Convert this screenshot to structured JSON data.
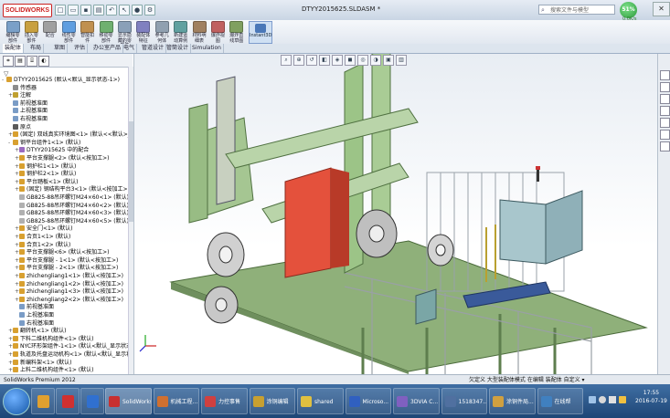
{
  "app": {
    "name": "SOLIDWORKS",
    "document_title": "DTYY2015625.SLDASM *",
    "search_placeholder": "搜索文件与模型",
    "cpu_badge": "51%",
    "cpu_sub": "0.0K/s"
  },
  "toolbar": {
    "tools": [
      {
        "label": "编辑零\n部件",
        "color": "#7aa0c8"
      },
      {
        "label": "插入零\n部件",
        "color": "#c8a040"
      },
      {
        "label": "配合",
        "color": "#a0a0a0"
      },
      {
        "label": "线性零\n部件",
        "color": "#5f9ee0"
      },
      {
        "label": "智能扣\n件",
        "color": "#c09050"
      },
      {
        "label": "移动零\n部件",
        "color": "#6fb06f"
      },
      {
        "label": "显示隐\n藏的零\n部件",
        "color": "#8aa0b8"
      },
      {
        "label": "装配体\n特征",
        "color": "#8080c0"
      },
      {
        "label": "参考几\n何体",
        "color": "#90a0b0"
      },
      {
        "label": "新建运\n动算例",
        "color": "#60a0a0"
      },
      {
        "label": "材料明\n细表",
        "color": "#a08060"
      },
      {
        "label": "爆炸视\n图",
        "color": "#c06060"
      },
      {
        "label": "爆炸直\n线草图",
        "color": "#80a060"
      }
    ],
    "instant3d": "Instant3D"
  },
  "tabs": [
    "装配体",
    "布局",
    "草图",
    "评估",
    "办公室产品",
    "电气",
    "管道设计",
    "管筒设计",
    "Simulation"
  ],
  "tree": {
    "nodes": [
      {
        "text": "DTYY2015625 (默认<默认_显示状态-1>)",
        "depth": 0,
        "color": "#d8a030",
        "expand": "-"
      },
      {
        "text": "传感器",
        "depth": 1,
        "color": "#8c8c8c",
        "expand": ""
      },
      {
        "text": "注解",
        "depth": 1,
        "color": "#c0a030",
        "expand": "+"
      },
      {
        "text": "前视基准面",
        "depth": 1,
        "color": "#7a9cc6",
        "expand": ""
      },
      {
        "text": "上视基准面",
        "depth": 1,
        "color": "#7a9cc6",
        "expand": ""
      },
      {
        "text": "右视基准面",
        "depth": 1,
        "color": "#7a9cc6",
        "expand": ""
      },
      {
        "text": "原点",
        "depth": 1,
        "color": "#5a5a5a",
        "expand": ""
      },
      {
        "text": "(固定) 双线真实环境图<1> (默认<<默认>_显示状态 1>)",
        "depth": 1,
        "color": "#d8a030",
        "expand": "+"
      },
      {
        "text": "钢平台组件1<1> (默认)",
        "depth": 1,
        "color": "#d8a030",
        "expand": "-"
      },
      {
        "text": "DTYY2015625 中的配合",
        "depth": 2,
        "color": "#9a6ac0",
        "expand": "+"
      },
      {
        "text": "平台支撑腿<2> (默认<按加工>)",
        "depth": 2,
        "color": "#d8a030",
        "expand": "+"
      },
      {
        "text": "钢护栏1<1> (默认)",
        "depth": 2,
        "color": "#d8a030",
        "expand": "+"
      },
      {
        "text": "钢护栏2<1> (默认)",
        "depth": 2,
        "color": "#d8a030",
        "expand": "+"
      },
      {
        "text": "平台踏板<1> (默认)",
        "depth": 2,
        "color": "#d8a030",
        "expand": "+"
      },
      {
        "text": "(固定) 钢结构平台3<1> (默认<按加工>)",
        "depth": 2,
        "color": "#d8a030",
        "expand": "+"
      },
      {
        "text": "GB825-88吊环螺钉M24×60<1> (默认)",
        "depth": 2,
        "color": "#b0b0b0",
        "expand": ""
      },
      {
        "text": "GB825-88吊环螺钉M24×60<2> (默认)",
        "depth": 2,
        "color": "#b0b0b0",
        "expand": ""
      },
      {
        "text": "GB825-88吊环螺钉M24×60<3> (默认)",
        "depth": 2,
        "color": "#b0b0b0",
        "expand": ""
      },
      {
        "text": "GB825-88吊环螺钉M24×60<5> (默认)",
        "depth": 2,
        "color": "#b0b0b0",
        "expand": ""
      },
      {
        "text": "安全门<1> (默认)",
        "depth": 2,
        "color": "#d8a030",
        "expand": "+"
      },
      {
        "text": "合页1<1> (默认)",
        "depth": 2,
        "color": "#d8a030",
        "expand": "+"
      },
      {
        "text": "合页1<2> (默认)",
        "depth": 2,
        "color": "#d8a030",
        "expand": "+"
      },
      {
        "text": "平台支撑腿<6> (默认<按加工>)",
        "depth": 2,
        "color": "#d8a030",
        "expand": "+"
      },
      {
        "text": "平台支撑腿 - 1<1> (默认<按加工>)",
        "depth": 2,
        "color": "#d8a030",
        "expand": "+"
      },
      {
        "text": "平台支撑腿 - 2<1> (默认<按加工>)",
        "depth": 2,
        "color": "#d8a030",
        "expand": "+"
      },
      {
        "text": "zhichengliang1<1> (默认<按加工>)",
        "depth": 2,
        "color": "#d8a030",
        "expand": "+"
      },
      {
        "text": "zhichengliang1<2> (默认<按加工>)",
        "depth": 2,
        "color": "#d8a030",
        "expand": "+"
      },
      {
        "text": "zhichengliang1<3> (默认<按加工>)",
        "depth": 2,
        "color": "#d8a030",
        "expand": "+"
      },
      {
        "text": "zhichengliang2<2> (默认<按加工>)",
        "depth": 2,
        "color": "#d8a030",
        "expand": "+"
      },
      {
        "text": "前视基准面",
        "depth": 2,
        "color": "#7a9cc6",
        "expand": ""
      },
      {
        "text": "上视基准面",
        "depth": 2,
        "color": "#7a9cc6",
        "expand": ""
      },
      {
        "text": "右视基准面",
        "depth": 2,
        "color": "#7a9cc6",
        "expand": ""
      },
      {
        "text": "翻转机<1> (默认)",
        "depth": 1,
        "color": "#d8a030",
        "expand": "+"
      },
      {
        "text": "下料二维机构组件<1> (默认)",
        "depth": 1,
        "color": "#d8a030",
        "expand": "+"
      },
      {
        "text": "NYC环形架组件-1<1> (默认<默认_显示状态-1>)",
        "depth": 1,
        "color": "#d8a030",
        "expand": "+"
      },
      {
        "text": "轨道及托盘运动机构<1> (默认<默认_显示状态-1>)",
        "depth": 1,
        "color": "#d8a030",
        "expand": "+"
      },
      {
        "text": "新编料架<1> (默认)",
        "depth": 1,
        "color": "#d8a030",
        "expand": "+"
      },
      {
        "text": "上料二维机构组件<1> (默认)",
        "depth": 1,
        "color": "#d8a030",
        "expand": "+"
      }
    ]
  },
  "status": {
    "left": "SolidWorks Premium 2012",
    "right": "欠定义   大型装配体模式   在编辑 装配体                        自定义 ▾"
  },
  "taskbar": {
    "buttons": [
      {
        "label": "SolidWorks",
        "color": "#c83030"
      },
      {
        "label": "机械工程...",
        "color": "#d07030"
      },
      {
        "label": "力控事售",
        "color": "#d04040"
      },
      {
        "label": "涂铜编辑",
        "color": "#c8a030"
      },
      {
        "label": "shared",
        "color": "#e0c040"
      },
      {
        "label": "Microso...",
        "color": "#3060c0"
      },
      {
        "label": "3DVIA C...",
        "color": "#8060c0"
      },
      {
        "label": "1518347...",
        "color": "#5070a0"
      },
      {
        "label": "涂铜件局...",
        "color": "#d0a040"
      },
      {
        "label": "在线帮",
        "color": "#4080c0"
      }
    ],
    "pins": [
      "#e0a030",
      "#d03030",
      "#3070d0"
    ],
    "time": "17:55",
    "date": "2016-07-19"
  }
}
